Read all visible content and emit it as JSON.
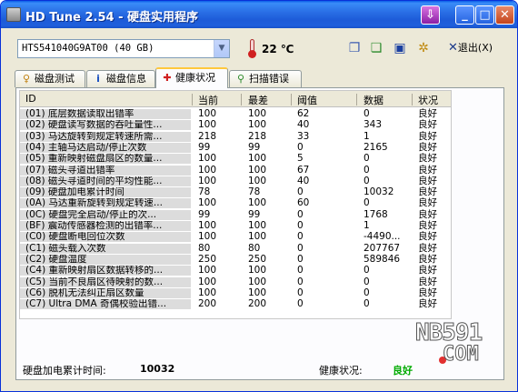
{
  "window": {
    "title": "HD Tune 2.54 - 硬盘实用程序"
  },
  "toolbar": {
    "drive": "HTS541040G9AT00 (40 GB)",
    "temperature": "22 ℃",
    "exit_label": "退出(X)"
  },
  "tabs": [
    {
      "label": "磁盘测试",
      "icon": "benchmark-icon"
    },
    {
      "label": "磁盘信息",
      "icon": "info-icon"
    },
    {
      "label": "健康状况",
      "icon": "health-cross-icon",
      "active": true
    },
    {
      "label": "扫描错误",
      "icon": "scan-magnifier-icon"
    }
  ],
  "table": {
    "headers": {
      "id": "ID",
      "current": "当前",
      "worst": "最差",
      "threshold": "阈值",
      "data": "数据",
      "status": "状况"
    },
    "rows": [
      {
        "id": "(01) 底层数据读取出错率",
        "current": "100",
        "worst": "100",
        "threshold": "62",
        "data": "0",
        "status": "良好"
      },
      {
        "id": "(02) 硬盘读写数据的吞吐量性...",
        "current": "100",
        "worst": "100",
        "threshold": "40",
        "data": "343",
        "status": "良好"
      },
      {
        "id": "(03) 马达旋转到规定转速所需...",
        "current": "218",
        "worst": "218",
        "threshold": "33",
        "data": "1",
        "status": "良好"
      },
      {
        "id": "(04) 主轴马达启动/停止次数",
        "current": "99",
        "worst": "99",
        "threshold": "0",
        "data": "2165",
        "status": "良好"
      },
      {
        "id": "(05) 重新映射磁盘扇区的数量...",
        "current": "100",
        "worst": "100",
        "threshold": "5",
        "data": "0",
        "status": "良好"
      },
      {
        "id": "(07) 磁头寻道出错率",
        "current": "100",
        "worst": "100",
        "threshold": "67",
        "data": "0",
        "status": "良好"
      },
      {
        "id": "(08) 磁头寻道时间的平均性能...",
        "current": "100",
        "worst": "100",
        "threshold": "40",
        "data": "0",
        "status": "良好"
      },
      {
        "id": "(09) 硬盘加电累计时间",
        "current": "78",
        "worst": "78",
        "threshold": "0",
        "data": "10032",
        "status": "良好"
      },
      {
        "id": "(0A) 马达重新旋转到规定转速...",
        "current": "100",
        "worst": "100",
        "threshold": "60",
        "data": "0",
        "status": "良好"
      },
      {
        "id": "(0C) 硬盘完全启动/停止的次...",
        "current": "99",
        "worst": "99",
        "threshold": "0",
        "data": "1768",
        "status": "良好"
      },
      {
        "id": "(BF) 震动传感器检测的出错率...",
        "current": "100",
        "worst": "100",
        "threshold": "0",
        "data": "1",
        "status": "良好"
      },
      {
        "id": "(C0) 硬盘断电回位次数",
        "current": "100",
        "worst": "100",
        "threshold": "0",
        "data": "-4490...",
        "status": "良好"
      },
      {
        "id": "(C1) 磁头载入次数",
        "current": "80",
        "worst": "80",
        "threshold": "0",
        "data": "207767",
        "status": "良好"
      },
      {
        "id": "(C2) 硬盘温度",
        "current": "250",
        "worst": "250",
        "threshold": "0",
        "data": "589846",
        "status": "良好"
      },
      {
        "id": "(C4) 重新映射扇区数据转移的...",
        "current": "100",
        "worst": "100",
        "threshold": "0",
        "data": "0",
        "status": "良好"
      },
      {
        "id": "(C5) 当前不良扇区待映射的数...",
        "current": "100",
        "worst": "100",
        "threshold": "0",
        "data": "0",
        "status": "良好"
      },
      {
        "id": "(C6) 脱机无法纠正扇区数量",
        "current": "100",
        "worst": "100",
        "threshold": "0",
        "data": "0",
        "status": "良好"
      },
      {
        "id": "(C7) Ultra DMA 奇偶校验出错...",
        "current": "200",
        "worst": "200",
        "threshold": "0",
        "data": "0",
        "status": "良好"
      }
    ]
  },
  "footer": {
    "power_on_label": "硬盘加电累计时间:",
    "power_on_value": "10032",
    "health_label": "健康状况:",
    "health_value": "良好",
    "health_color": "#00aa00"
  },
  "watermark": {
    "line1": "NB591",
    "line2": "COM"
  }
}
